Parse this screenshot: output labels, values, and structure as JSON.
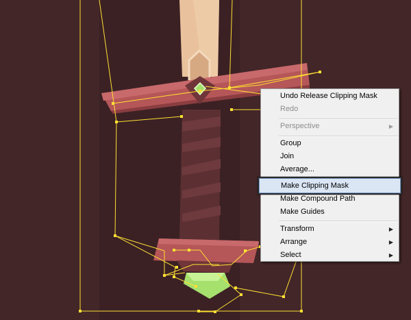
{
  "menu": {
    "items": [
      {
        "label": "Undo Release Clipping Mask",
        "enabled": true
      },
      {
        "label": "Redo",
        "enabled": false
      },
      {
        "label": "Perspective",
        "enabled": false,
        "submenu": true
      },
      {
        "label": "Group",
        "enabled": true
      },
      {
        "label": "Join",
        "enabled": true
      },
      {
        "label": "Average...",
        "enabled": true
      },
      {
        "label": "Make Clipping Mask",
        "enabled": true,
        "highlighted": true
      },
      {
        "label": "Make Compound Path",
        "enabled": true
      },
      {
        "label": "Make Guides",
        "enabled": true
      },
      {
        "label": "Transform",
        "enabled": true,
        "submenu": true
      },
      {
        "label": "Arrange",
        "enabled": true,
        "submenu": true
      },
      {
        "label": "Select",
        "enabled": true,
        "submenu": true
      }
    ],
    "submenu_arrow": "▶"
  },
  "colors": {
    "background": "#422628",
    "selection": "#ffe033",
    "guard": "#b55658",
    "grip": "#5c3033",
    "blade": "#e9c29d",
    "gem": "#a6e06d",
    "highlight": "#dbe6f4"
  },
  "icons": [
    "submenu-arrow-icon",
    "gem-icon"
  ]
}
